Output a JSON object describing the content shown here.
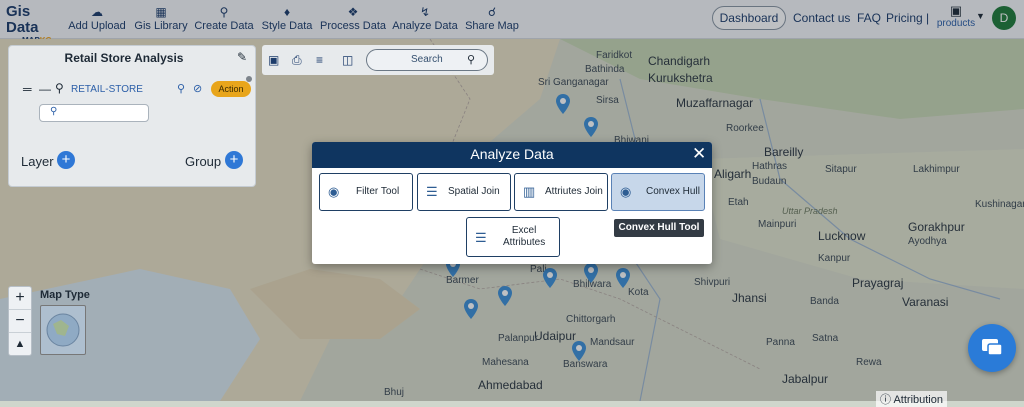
{
  "app": {
    "logo_line1": "Gis Data",
    "logo_line2": "MAP",
    "logo_line2_accent": "KG"
  },
  "nav": {
    "items": [
      {
        "label": "Add Upload",
        "icon": "cloud-upload-icon"
      },
      {
        "label": "Gis Library",
        "icon": "library-icon"
      },
      {
        "label": "Create Data",
        "icon": "location-pin-icon"
      },
      {
        "label": "Style Data",
        "icon": "paint-bucket-icon"
      },
      {
        "label": "Process Data",
        "icon": "process-icon"
      },
      {
        "label": "Analyze Data",
        "icon": "analyze-icon"
      },
      {
        "label": "Share Map",
        "icon": "share-icon"
      }
    ],
    "dashboard": "Dashboard",
    "contact": "Contact us",
    "faq": "FAQ",
    "pricing": "Pricing |",
    "products": "products",
    "avatar_initial": "D"
  },
  "panel": {
    "title": "Retail Store Analysis",
    "layer_name": "RETAIL-STORE",
    "action_label": "Action",
    "layer_label": "Layer",
    "group_label": "Group"
  },
  "map_toolbar": {
    "search_placeholder": "Search"
  },
  "map": {
    "type_label": "Map Type",
    "attribution": "Attribution",
    "labels": [
      "Faridkot",
      "Chandigarh",
      "Bathinda",
      "Kurukshetra",
      "Sri Ganganagar",
      "Muzaffarnagar",
      "Sirsa",
      "Bhiwani",
      "Roorkee",
      "Bareilly",
      "Aligarh",
      "Budaun",
      "Sitapur",
      "Lakhimpur",
      "Lucknow",
      "Gorakhpur",
      "Kushinagar",
      "Etah",
      "Uttar Pradesh",
      "Ayodhya",
      "Barmer",
      "Bhilwara",
      "Kota",
      "Shivpuri",
      "Jhansi",
      "Prayagraj",
      "Varanasi",
      "Banda",
      "Chittorgarh",
      "Udaipur",
      "Palanpur",
      "Mandsaur",
      "Mahesana",
      "Banswara",
      "Panna",
      "Satna",
      "Ahmedabad",
      "Jabalpur",
      "Rewa",
      "Bhuj",
      "Pali",
      "Hathras",
      "Kanpur",
      "Mainpuri"
    ]
  },
  "modal": {
    "title": "Analyze Data",
    "tools": [
      {
        "label": "Filter Tool",
        "icon": "filter-globe-icon"
      },
      {
        "label": "Spatial Join",
        "icon": "layers-icon"
      },
      {
        "label": "Attriutes Join",
        "icon": "bar-chart-icon"
      },
      {
        "label": "Convex Hull",
        "icon": "hull-globe-icon"
      }
    ],
    "excel": {
      "line1": "Excel",
      "line2": "Attributes",
      "icon": "layers-icon"
    },
    "tooltip": "Convex Hull Tool"
  },
  "colors": {
    "navy": "#0f3560",
    "pin_blue": "#3d8fd6",
    "accent_orange": "#e8a51b",
    "avatar_green": "#1f7a3a"
  }
}
